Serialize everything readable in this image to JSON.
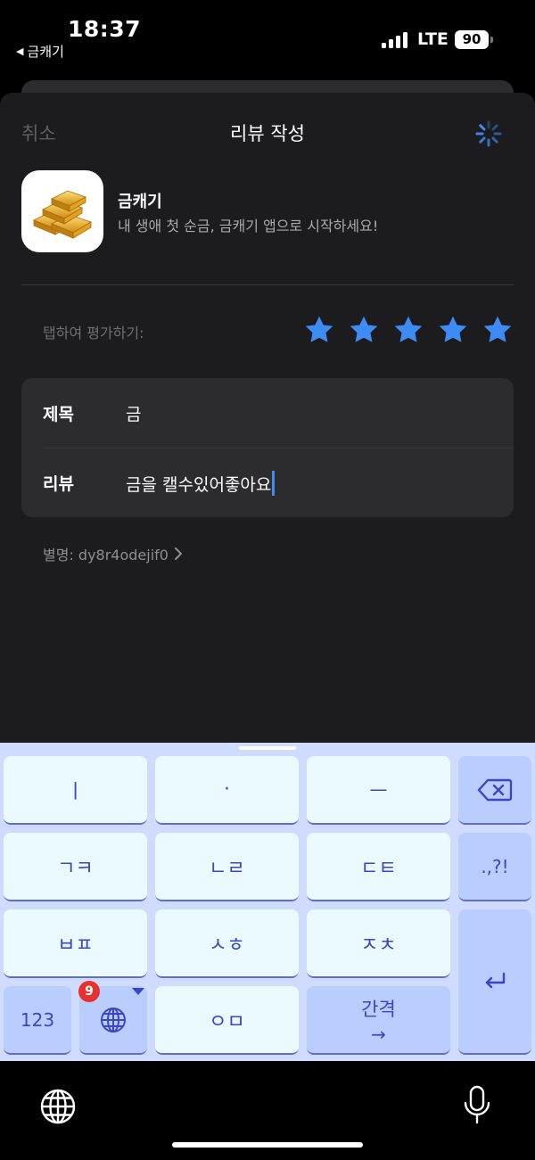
{
  "status_bar": {
    "time": "18:37",
    "back_app": "금캐기",
    "network": "LTE",
    "battery": "90"
  },
  "nav": {
    "cancel": "취소",
    "title": "리뷰 작성",
    "loading_icon": "activity-spinner-icon"
  },
  "app": {
    "name": "금캐기",
    "subtitle": "내 생애 첫 순금, 금캐기 앱으로 시작하세요!",
    "icon": "gold-bars-icon"
  },
  "rating": {
    "label": "탭하여 평가하기:",
    "stars_filled": 5,
    "stars_total": 5,
    "color": "#3f8bf5"
  },
  "form": {
    "title_label": "제목",
    "title_value": "금",
    "review_label": "리뷰",
    "review_value": "금을 캘수있어좋아요"
  },
  "nickname": {
    "text": "별명: dy8r4odejif0"
  },
  "keyboard": {
    "keys": {
      "k1": "ㅣ",
      "k2": "·",
      "k3": "ㅡ",
      "k4": "ㄱㅋ",
      "k5": "ㄴㄹ",
      "k6": "ㄷㅌ",
      "k7": ".,?!",
      "k8": "ㅂㅍ",
      "k9": "ㅅㅎ",
      "k10": "ㅈㅊ",
      "num": "123",
      "k11": "ㅇㅁ",
      "space": "간격",
      "space_arrow": "→"
    },
    "badge": "9",
    "colors": {
      "background": "#cfdcff",
      "key": "#eafaff",
      "accent": "#3b46c4"
    }
  }
}
